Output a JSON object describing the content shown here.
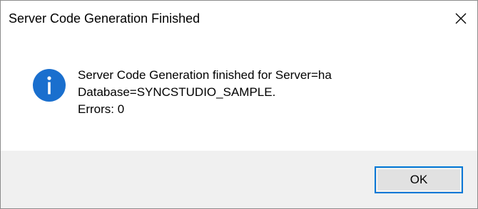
{
  "window": {
    "title": "Server Code Generation Finished",
    "close_icon": "close-icon"
  },
  "message": {
    "icon": "info-icon",
    "icon_color": "#1a6fce",
    "lines": [
      "Server Code Generation finished for Server=ha",
      "Database=SYNCSTUDIO_SAMPLE.",
      "Errors: 0"
    ]
  },
  "buttons": {
    "ok_label": "OK"
  },
  "colors": {
    "focus_border": "#0078d7",
    "button_face": "#e1e1e1",
    "footer_bg": "#f0f0f0"
  }
}
